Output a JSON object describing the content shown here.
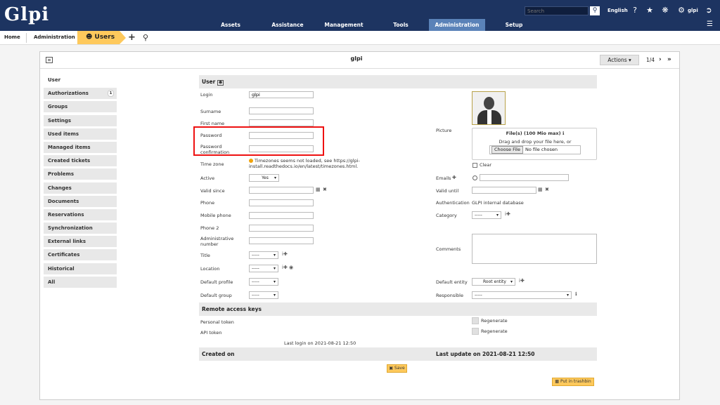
{
  "app": {
    "logo_text": "Glpi"
  },
  "topbar": {
    "search_placeholder": "Search",
    "language": "English",
    "username": "glpi"
  },
  "menu": {
    "items": [
      "Assets",
      "Assistance",
      "Management",
      "Tools",
      "Administration",
      "Setup"
    ],
    "active": "Administration"
  },
  "breadcrumb": {
    "home": "Home",
    "section": "Administration",
    "current": "Users"
  },
  "record": {
    "title": "glpi",
    "actions_label": "Actions",
    "pager": "1/4"
  },
  "tabs": [
    {
      "label": "User",
      "active": true
    },
    {
      "label": "Authorizations",
      "badge": "1"
    },
    {
      "label": "Groups"
    },
    {
      "label": "Settings"
    },
    {
      "label": "Used items"
    },
    {
      "label": "Managed items"
    },
    {
      "label": "Created tickets"
    },
    {
      "label": "Problems"
    },
    {
      "label": "Changes"
    },
    {
      "label": "Documents"
    },
    {
      "label": "Reservations"
    },
    {
      "label": "Synchronization"
    },
    {
      "label": "External links"
    },
    {
      "label": "Certificates"
    },
    {
      "label": "Historical"
    },
    {
      "label": "All"
    }
  ],
  "form": {
    "section_user": "User",
    "login_label": "Login",
    "login_value": "glpi",
    "surname_label": "Surname",
    "firstname_label": "First name",
    "password_label": "Password",
    "password_confirm_label": "Password confirmation",
    "timezone_label": "Time zone",
    "timezone_warning": "Timezones seems not loaded, see https://glpi-install.readthedocs.io/en/latest/timezones.html.",
    "active_label": "Active",
    "active_value": "Yes",
    "valid_since_label": "Valid since",
    "phone_label": "Phone",
    "mobile_label": "Mobile phone",
    "phone2_label": "Phone 2",
    "admin_number_label": "Administrative number",
    "title_label": "Title",
    "location_label": "Location",
    "default_profile_label": "Default profile",
    "default_group_label": "Default group",
    "empty_select": "-----",
    "picture_label": "Picture",
    "file_label": "File(s) (100 Mio max)",
    "drop_text": "Drag and drop your file here, or",
    "choose_file": "Choose File",
    "no_file": "No file chosen",
    "clear_label": "Clear",
    "emails_label": "Emails",
    "valid_until_label": "Valid until",
    "auth_label": "Authentication",
    "auth_value": "GLPI internal database",
    "category_label": "Category",
    "comments_label": "Comments",
    "default_entity_label": "Default entity",
    "default_entity_value": "Root entity",
    "responsible_label": "Responsible",
    "section_remote": "Remote access keys",
    "personal_token_label": "Personal token",
    "api_token_label": "API token",
    "regenerate_label": "Regenerate",
    "last_login": "Last login on 2021-08-21 12:50",
    "created_on_label": "Created on",
    "last_update": "Last update on 2021-08-21 12:50",
    "save_label": "Save",
    "trash_label": "Put in trashbin"
  },
  "colors": {
    "topbar": "#1d3461",
    "active_menu": "#5a82b8",
    "accent": "#fec95c",
    "highlight": "#e11111"
  }
}
